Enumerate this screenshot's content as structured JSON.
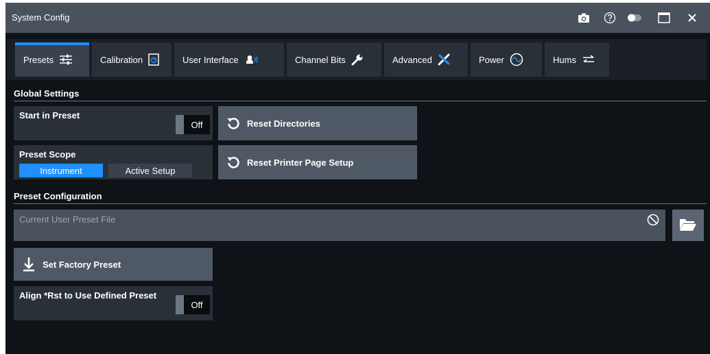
{
  "window": {
    "title": "System Config"
  },
  "tabs": [
    {
      "label": "Presets",
      "icon": "sliders-icon",
      "active": true
    },
    {
      "label": "Calibration",
      "icon": "calibration-icon",
      "active": false
    },
    {
      "label": "User Interface",
      "icon": "user-voice-icon",
      "active": false
    },
    {
      "label": "Channel Bits",
      "icon": "wrench-icon",
      "active": false
    },
    {
      "label": "Advanced",
      "icon": "tools-icon",
      "active": false
    },
    {
      "label": "Power",
      "icon": "sine-wave-icon",
      "active": false
    },
    {
      "label": "Hums",
      "icon": "swap-arrows-icon",
      "active": false
    }
  ],
  "global_settings": {
    "heading": "Global Settings",
    "start_in_preset": {
      "label": "Start in Preset",
      "state": "Off"
    },
    "preset_scope": {
      "label": "Preset Scope",
      "options": [
        "Instrument",
        "Active Setup"
      ],
      "selected": "Instrument"
    },
    "reset_directories": "Reset Directories",
    "reset_printer": "Reset Printer Page Setup"
  },
  "preset_configuration": {
    "heading": "Preset Configuration",
    "file_placeholder": "Current User Preset File",
    "set_factory_preset": "Set Factory Preset",
    "align_rst": {
      "label": "Align *Rst to Use Defined Preset",
      "state": "Off"
    }
  },
  "colors": {
    "accent": "#1e90ff",
    "titlebar": "#4a525d",
    "background": "#0f1216",
    "button": "#4f5966"
  }
}
